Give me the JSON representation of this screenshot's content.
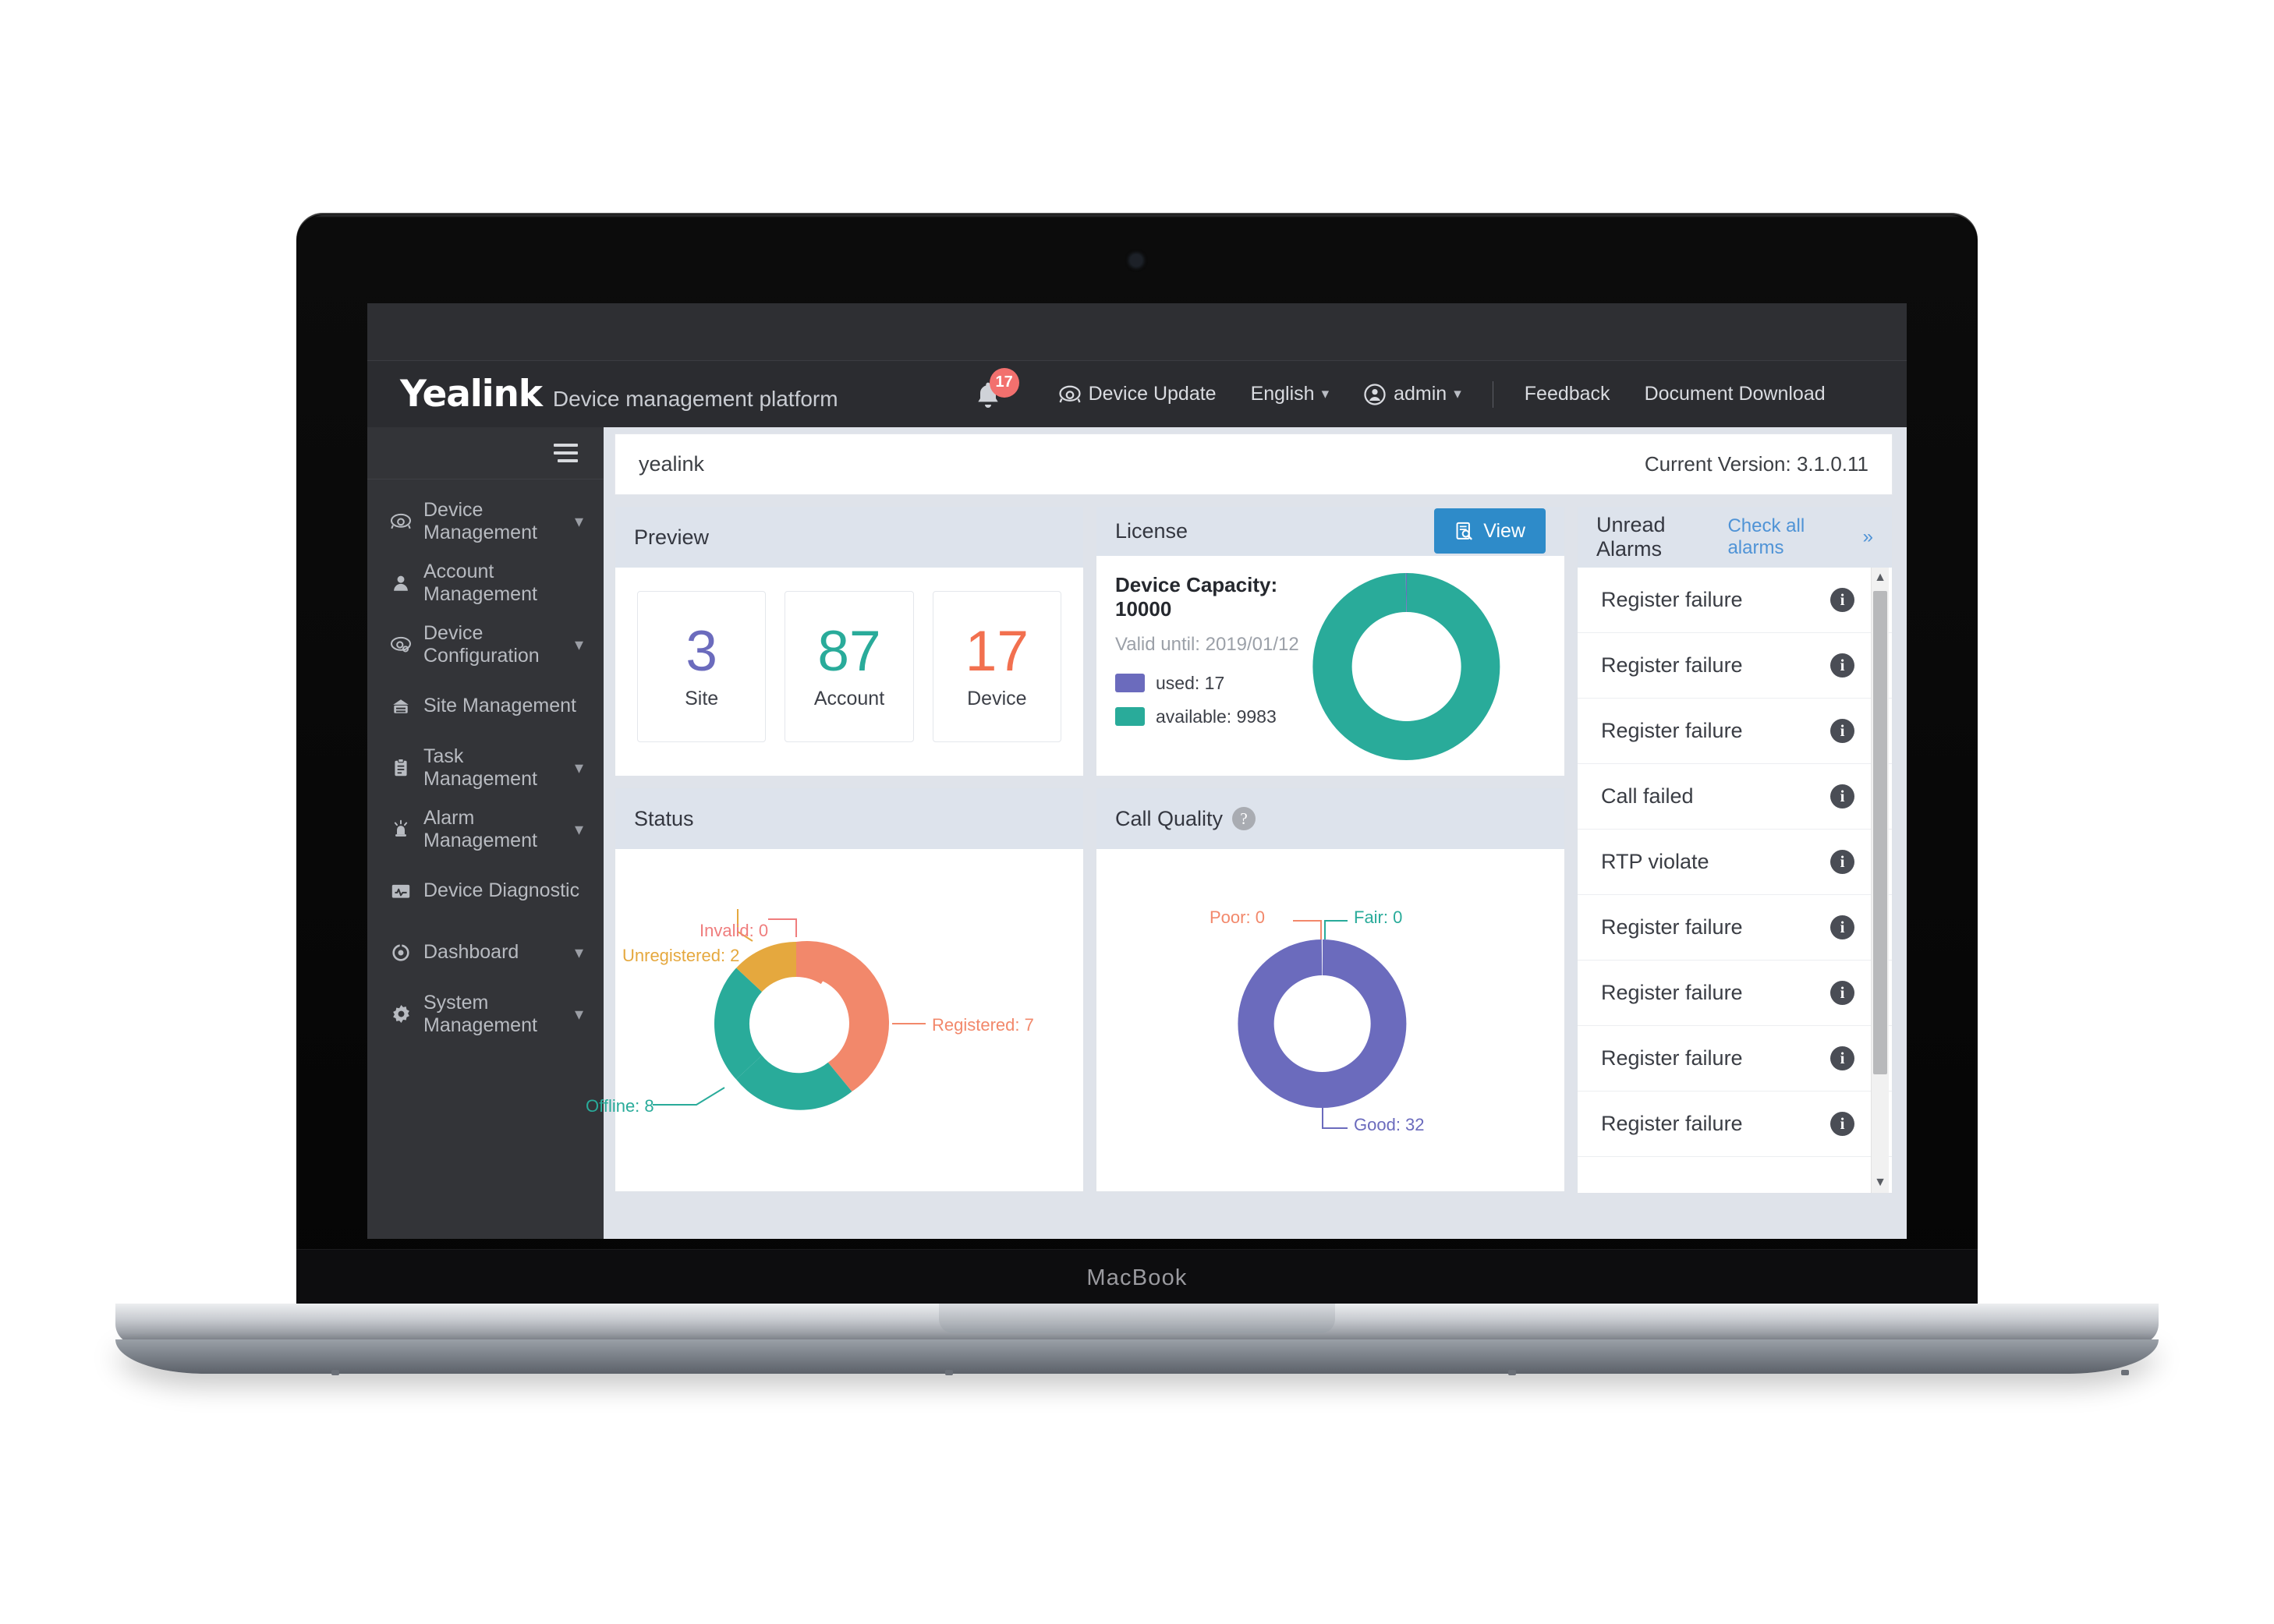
{
  "device": {
    "model_label": "MacBook"
  },
  "navbar": {
    "brand": "Yealink",
    "subtitle": "Device management platform",
    "notification_count": "17",
    "bell_icon": "bell-icon",
    "items": [
      {
        "label": "Device Update",
        "icon": "phone-icon"
      },
      {
        "label": "English",
        "icon": "chevron-down-icon"
      },
      {
        "label": "admin",
        "icon": "user-circle-icon"
      },
      {
        "label": "Feedback",
        "icon": ""
      },
      {
        "label": "Document Download",
        "icon": ""
      }
    ]
  },
  "sidebar": {
    "collapse_icon": "hamburger-icon",
    "items": [
      {
        "label": "Device Management",
        "icon": "phone-icon",
        "expandable": true
      },
      {
        "label": "Account Management",
        "icon": "user-icon",
        "expandable": false
      },
      {
        "label": "Device Configuration",
        "icon": "phone-gear-icon",
        "expandable": true
      },
      {
        "label": "Site Management",
        "icon": "building-icon",
        "expandable": false
      },
      {
        "label": "Task Management",
        "icon": "clipboard-icon",
        "expandable": true
      },
      {
        "label": "Alarm Management",
        "icon": "alarm-light-icon",
        "expandable": true
      },
      {
        "label": "Device Diagnostic",
        "icon": "monitor-wave-icon",
        "expandable": false
      },
      {
        "label": "Dashboard",
        "icon": "gauge-icon",
        "expandable": true
      },
      {
        "label": "System Management",
        "icon": "gear-icon",
        "expandable": true
      }
    ]
  },
  "breadcrumb": {
    "text": "yealink",
    "version": "Current Version: 3.1.0.11"
  },
  "preview": {
    "title": "Preview",
    "stats": [
      {
        "value": "3",
        "label": "Site",
        "color": "#6b6bbd"
      },
      {
        "value": "87",
        "label": "Account",
        "color": "#29ab9a"
      },
      {
        "value": "17",
        "label": "Device",
        "color": "#f2704f"
      }
    ]
  },
  "license": {
    "title": "License",
    "view_button": "View",
    "view_icon": "document-search-icon",
    "capacity": "Device Capacity: 10000",
    "valid_until": "Valid until: 2019/01/12",
    "legend": [
      {
        "label": "used: 17",
        "color": "#6b6bbd"
      },
      {
        "label": "available: 9983",
        "color": "#29ab9a"
      }
    ]
  },
  "status_card": {
    "title": "Status"
  },
  "call_quality_card": {
    "title": "Call Quality",
    "help_icon": "question-mark-icon"
  },
  "alarms": {
    "title": "Unread Alarms",
    "check_all": "Check all alarms",
    "check_all_icon": "double-chevron-right-icon",
    "info_icon": "info-icon",
    "items": [
      "Register failure",
      "Register failure",
      "Register failure",
      "Call failed",
      "RTP violate",
      "Register failure",
      "Register failure",
      "Register failure",
      "Register failure"
    ]
  },
  "chart_data": [
    {
      "type": "pie",
      "title": "License",
      "id": "license-donut",
      "labels": [
        "used",
        "available"
      ],
      "values": [
        17,
        9983
      ],
      "colors": [
        "#6b6bbd",
        "#29ab9a"
      ],
      "total": 10000,
      "legend": "left",
      "donut": true
    },
    {
      "type": "pie",
      "title": "Status",
      "id": "status-donut",
      "labels": [
        "Registered",
        "Offline",
        "Unregistered",
        "Invalid"
      ],
      "values": [
        7,
        8,
        2,
        0
      ],
      "colors": [
        "#f2886b",
        "#29ab9a",
        "#e5a83e",
        "#ef7d7d"
      ],
      "annotations": [
        "Registered: 7",
        "Offline: 8",
        "Unregistered: 2",
        "Invalid: 0"
      ],
      "total": 17,
      "donut": true
    },
    {
      "type": "pie",
      "title": "Call Quality",
      "id": "call-quality-donut",
      "labels": [
        "Good",
        "Fair",
        "Poor"
      ],
      "values": [
        32,
        0,
        0
      ],
      "colors": [
        "#6b6bbd",
        "#29ab9a",
        "#f2886b"
      ],
      "annotations": [
        "Good: 32",
        "Fair: 0",
        "Poor: 0"
      ],
      "total": 32,
      "donut": true
    }
  ]
}
